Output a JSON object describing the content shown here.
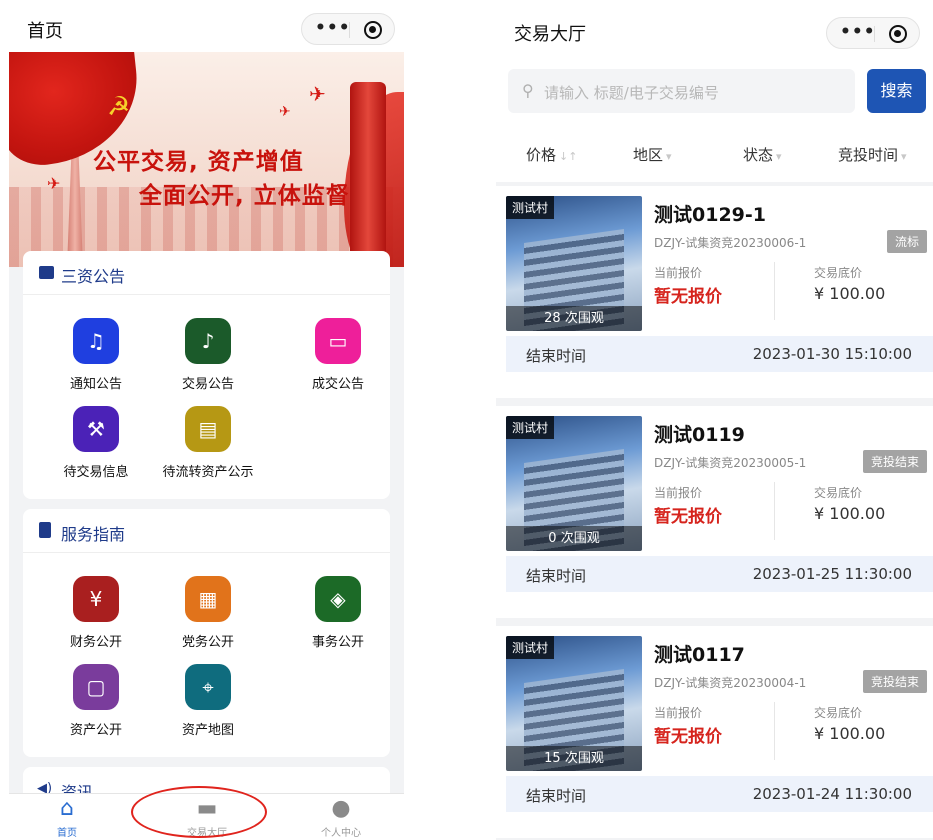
{
  "left": {
    "nav": {
      "title": "首页"
    },
    "banner": {
      "slogan1": "公平交易, 资产增值",
      "slogan2": "全面公开, 立体监督"
    },
    "sanzi": {
      "title": "三资公告",
      "items": [
        {
          "label": "通知公告",
          "color": "#1f3fe0"
        },
        {
          "label": "交易公告",
          "color": "#1b5a2a"
        },
        {
          "label": "成交公告",
          "color": "#ee1f9a"
        },
        {
          "label": "待交易信息",
          "color": "#4b22b7"
        },
        {
          "label": "待流转资产公示",
          "color": "#b69814"
        }
      ]
    },
    "guide": {
      "title": "服务指南",
      "items": [
        {
          "label": "财务公开",
          "color": "#a91f1f"
        },
        {
          "label": "党务公开",
          "color": "#e1731b"
        },
        {
          "label": "事务公开",
          "color": "#1c6a27"
        },
        {
          "label": "资产公开",
          "color": "#7a3c9c"
        },
        {
          "label": "资产地图",
          "color": "#0f6c7e"
        }
      ]
    },
    "news": {
      "title": "资讯"
    },
    "tabs": [
      {
        "label": "首页",
        "icon": "home-icon"
      },
      {
        "label": "交易大厅",
        "icon": "monitor-icon"
      },
      {
        "label": "个人中心",
        "icon": "person-icon"
      }
    ]
  },
  "right": {
    "nav": {
      "title": "交易大厅"
    },
    "search": {
      "placeholder": "请输入 标题/电子交易编号",
      "button": "搜索"
    },
    "filters": [
      "价格",
      "地区",
      "状态",
      "竞投时间"
    ],
    "items": [
      {
        "tag": "测试村",
        "views": "28 次围观",
        "title": "测试0129-1",
        "code": "DZJY-试集资竞20230006-1",
        "status": "流标",
        "label_current": "当前报价",
        "current": "暂无报价",
        "label_base": "交易底价",
        "base": "¥ 100.00",
        "end_label": "结束时间",
        "end_time": "2023-01-30 15:10:00"
      },
      {
        "tag": "测试村",
        "views": "0 次围观",
        "title": "测试0119",
        "code": "DZJY-试集资竞20230005-1",
        "status": "竞投结束",
        "label_current": "当前报价",
        "current": "暂无报价",
        "label_base": "交易底价",
        "base": "¥ 100.00",
        "end_label": "结束时间",
        "end_time": "2023-01-25 11:30:00"
      },
      {
        "tag": "测试村",
        "views": "15 次围观",
        "title": "测试0117",
        "code": "DZJY-试集资竞20230004-1",
        "status": "竞投结束",
        "label_current": "当前报价",
        "current": "暂无报价",
        "label_base": "交易底价",
        "base": "¥ 100.00",
        "end_label": "结束时间",
        "end_time": "2023-01-24 11:30:00"
      }
    ]
  }
}
